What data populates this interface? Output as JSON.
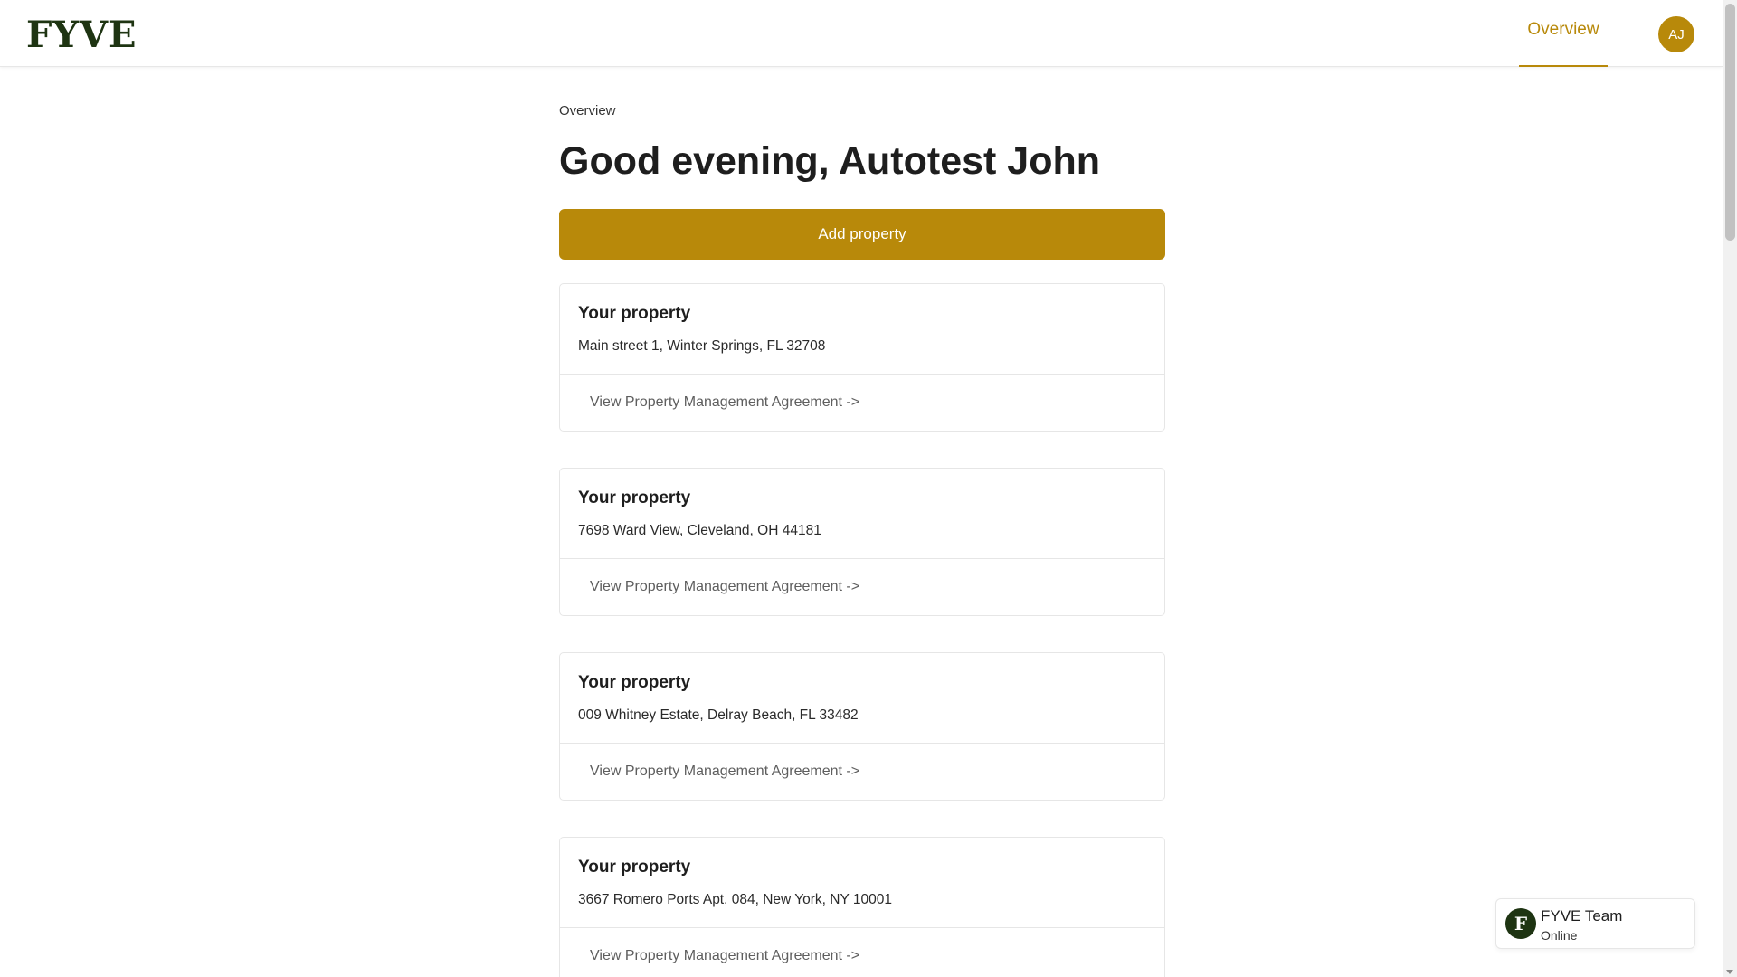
{
  "header": {
    "logo": "FYVE",
    "nav": {
      "overview": "Overview"
    },
    "avatar_initials": "AJ"
  },
  "main": {
    "breadcrumb": "Overview",
    "greeting": "Good evening, Autotest John",
    "add_property_label": "Add property",
    "properties": [
      {
        "title": "Your property",
        "address": "Main street 1, Winter Springs, FL 32708",
        "link": "View Property Management Agreement ->"
      },
      {
        "title": "Your property",
        "address": "7698 Ward View, Cleveland, OH 44181",
        "link": "View Property Management Agreement ->"
      },
      {
        "title": "Your property",
        "address": "009 Whitney Estate, Delray Beach, FL 33482",
        "link": "View Property Management Agreement ->"
      },
      {
        "title": "Your property",
        "address": "3667 Romero Ports Apt. 084, New York, NY 10001",
        "link": "View Property Management Agreement ->"
      }
    ]
  },
  "chat": {
    "icon_letter": "F",
    "name": "FYVE Team",
    "status": "Online"
  },
  "colors": {
    "accent": "#b8890a",
    "brand_dark": "#1e3412"
  }
}
